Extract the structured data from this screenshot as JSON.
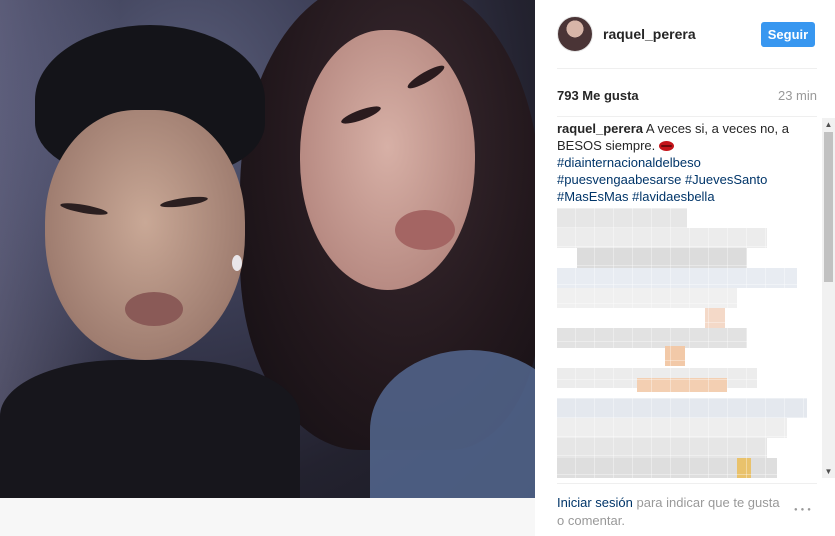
{
  "post": {
    "username": "raquel_perera",
    "follow_label": "Seguir",
    "likes": "793 Me gusta",
    "time": "23 min",
    "caption_user": "raquel_perera",
    "caption_text": "A veces si, a veces no, a BESOS siempre.",
    "caption_emoji": "lips-kiss-icon",
    "hashtags": [
      "#diainternacionaldelbeso",
      "#puesvengaabesarse",
      "#JuevesSanto",
      "#MasEsMas",
      "#lavidaesbella"
    ]
  },
  "footer": {
    "login_link": "Iniciar sesión",
    "login_text": "para indicar que te gusta o comentar.",
    "more_icon": "more-options-icon"
  },
  "colors": {
    "follow_button": "#3897f0",
    "link": "#003569",
    "muted": "#999999",
    "text": "#262626"
  }
}
